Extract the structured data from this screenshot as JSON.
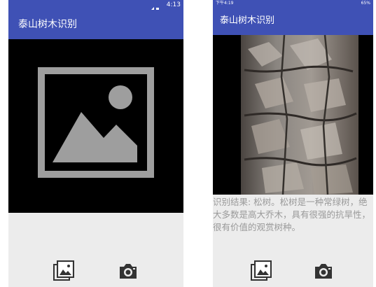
{
  "left_phone": {
    "status_time": "4:13",
    "app_title": "泰山树木识别",
    "image_placeholder_icon": "image-placeholder-icon",
    "buttons": [
      {
        "name": "gallery",
        "icon": "gallery-icon"
      },
      {
        "name": "camera",
        "icon": "camera-icon"
      }
    ]
  },
  "right_phone": {
    "status_time": "下午4:19",
    "status_right": "65%",
    "app_title": "泰山树木识别",
    "result_text": "识别结果: 松树。松树是一种常绿树，绝大多数是高大乔木，具有很强的抗旱性，很有价值的观赏树种。",
    "buttons": [
      {
        "name": "gallery",
        "icon": "gallery-icon"
      },
      {
        "name": "camera",
        "icon": "camera-icon"
      }
    ]
  },
  "colors": {
    "app_bar": "#3f51b5",
    "image_background": "#000000",
    "placeholder_gray": "#9e9e9e",
    "bottom_background": "#ececec",
    "icon_dark": "#333333"
  }
}
